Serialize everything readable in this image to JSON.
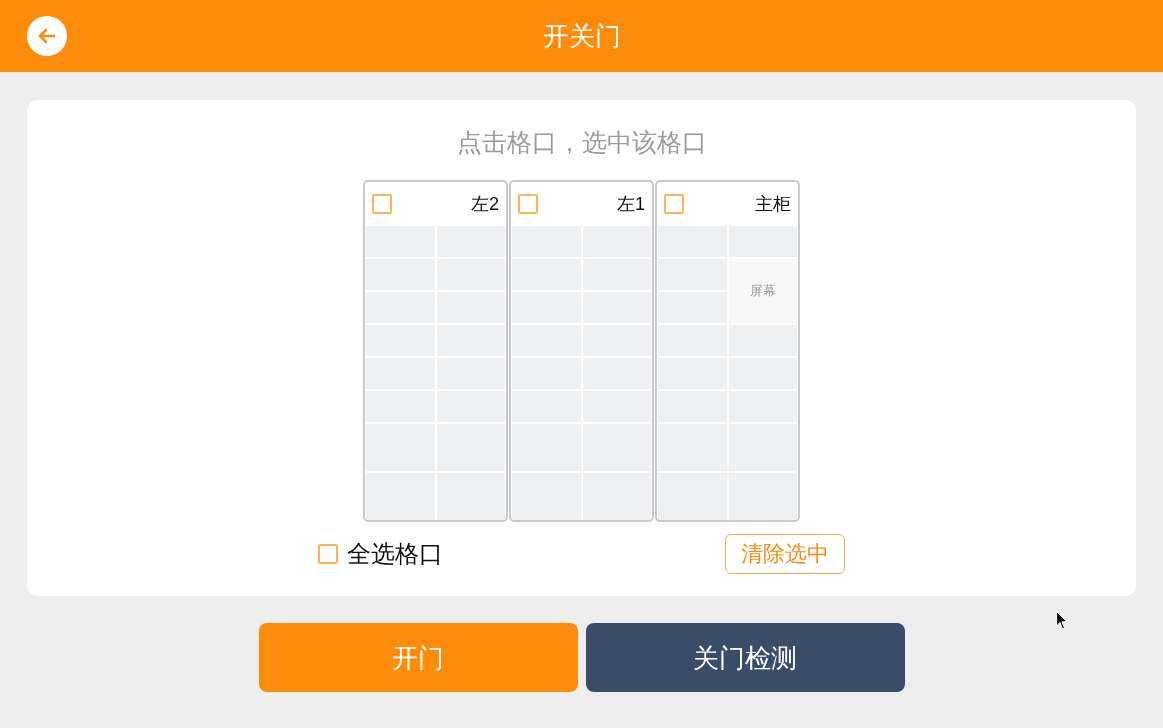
{
  "header": {
    "title": "开关门"
  },
  "panel": {
    "hint": "点击格口，选中该格口",
    "cabinets": [
      {
        "label": "左2",
        "checked": false,
        "columns": [
          {
            "cells": [
              {
                "kind": "small",
                "selected": false
              },
              {
                "kind": "small",
                "selected": false
              },
              {
                "kind": "small",
                "selected": false
              },
              {
                "kind": "small",
                "selected": false
              },
              {
                "kind": "small",
                "selected": false
              },
              {
                "kind": "small",
                "selected": false
              },
              {
                "kind": "large",
                "selected": false
              },
              {
                "kind": "large",
                "selected": false
              }
            ]
          },
          {
            "cells": [
              {
                "kind": "small",
                "selected": false
              },
              {
                "kind": "small",
                "selected": false
              },
              {
                "kind": "small",
                "selected": false
              },
              {
                "kind": "small",
                "selected": false
              },
              {
                "kind": "small",
                "selected": false
              },
              {
                "kind": "small",
                "selected": false
              },
              {
                "kind": "large",
                "selected": false
              },
              {
                "kind": "large",
                "selected": false
              }
            ]
          }
        ]
      },
      {
        "label": "左1",
        "checked": false,
        "columns": [
          {
            "cells": [
              {
                "kind": "small",
                "selected": false
              },
              {
                "kind": "small",
                "selected": false
              },
              {
                "kind": "small",
                "selected": false
              },
              {
                "kind": "small",
                "selected": false
              },
              {
                "kind": "small",
                "selected": false
              },
              {
                "kind": "small",
                "selected": false
              },
              {
                "kind": "large",
                "selected": false
              },
              {
                "kind": "large",
                "selected": false
              }
            ]
          },
          {
            "cells": [
              {
                "kind": "small",
                "selected": false
              },
              {
                "kind": "small",
                "selected": false
              },
              {
                "kind": "small",
                "selected": false
              },
              {
                "kind": "small",
                "selected": false
              },
              {
                "kind": "small",
                "selected": false
              },
              {
                "kind": "small",
                "selected": false
              },
              {
                "kind": "large",
                "selected": false
              },
              {
                "kind": "large",
                "selected": false
              }
            ]
          }
        ]
      },
      {
        "label": "主柜",
        "checked": false,
        "columns": [
          {
            "cells": [
              {
                "kind": "small",
                "selected": false
              },
              {
                "kind": "small",
                "selected": false
              },
              {
                "kind": "small",
                "selected": false
              },
              {
                "kind": "small",
                "selected": false
              },
              {
                "kind": "small",
                "selected": false
              },
              {
                "kind": "small",
                "selected": false
              },
              {
                "kind": "large",
                "selected": false
              },
              {
                "kind": "large",
                "selected": false
              }
            ]
          },
          {
            "cells": [
              {
                "kind": "small",
                "selected": false
              },
              {
                "kind": "screen",
                "label": "屏幕"
              },
              {
                "kind": "small",
                "selected": false
              },
              {
                "kind": "small",
                "selected": false
              },
              {
                "kind": "small",
                "selected": false
              },
              {
                "kind": "large",
                "selected": false
              },
              {
                "kind": "large",
                "selected": false
              }
            ]
          }
        ]
      }
    ],
    "select_all": {
      "label": "全选格口",
      "checked": false
    },
    "clear_button": "清除选中"
  },
  "actions": [
    {
      "label": "开门",
      "kind": "primary"
    },
    {
      "label": "关门检测",
      "kind": "secondary"
    }
  ]
}
